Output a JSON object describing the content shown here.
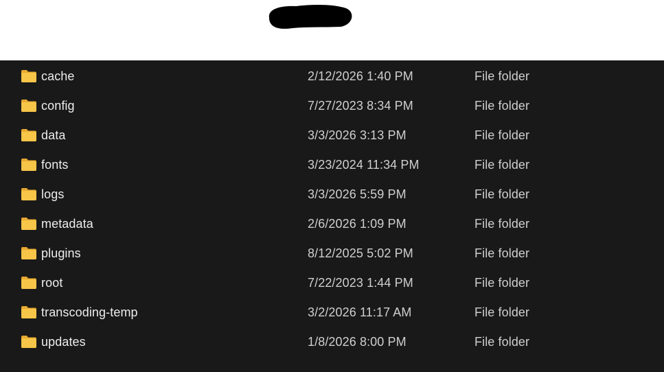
{
  "colors": {
    "pane_background": "#191919",
    "text_primary": "#ededed",
    "text_secondary": "#cfcfcf",
    "folder_yellow": "#f7c548",
    "folder_back": "#e8a931",
    "redaction": "#000000"
  },
  "header": {
    "redaction_icon": "redacted-scribble"
  },
  "files": [
    {
      "name": "cache",
      "date_modified": "2/12/2026 1:40 PM",
      "type": "File folder",
      "icon": "folder-icon"
    },
    {
      "name": "config",
      "date_modified": "7/27/2023 8:34 PM",
      "type": "File folder",
      "icon": "folder-icon"
    },
    {
      "name": "data",
      "date_modified": "3/3/2026 3:13 PM",
      "type": "File folder",
      "icon": "folder-icon"
    },
    {
      "name": "fonts",
      "date_modified": "3/23/2024 11:34 PM",
      "type": "File folder",
      "icon": "folder-icon"
    },
    {
      "name": "logs",
      "date_modified": "3/3/2026 5:59 PM",
      "type": "File folder",
      "icon": "folder-icon"
    },
    {
      "name": "metadata",
      "date_modified": "2/6/2026 1:09 PM",
      "type": "File folder",
      "icon": "folder-icon"
    },
    {
      "name": "plugins",
      "date_modified": "8/12/2025 5:02 PM",
      "type": "File folder",
      "icon": "folder-icon"
    },
    {
      "name": "root",
      "date_modified": "7/22/2023 1:44 PM",
      "type": "File folder",
      "icon": "folder-icon"
    },
    {
      "name": "transcoding-temp",
      "date_modified": "3/2/2026 11:17 AM",
      "type": "File folder",
      "icon": "folder-icon"
    },
    {
      "name": "updates",
      "date_modified": "1/8/2026 8:00 PM",
      "type": "File folder",
      "icon": "folder-icon"
    }
  ]
}
